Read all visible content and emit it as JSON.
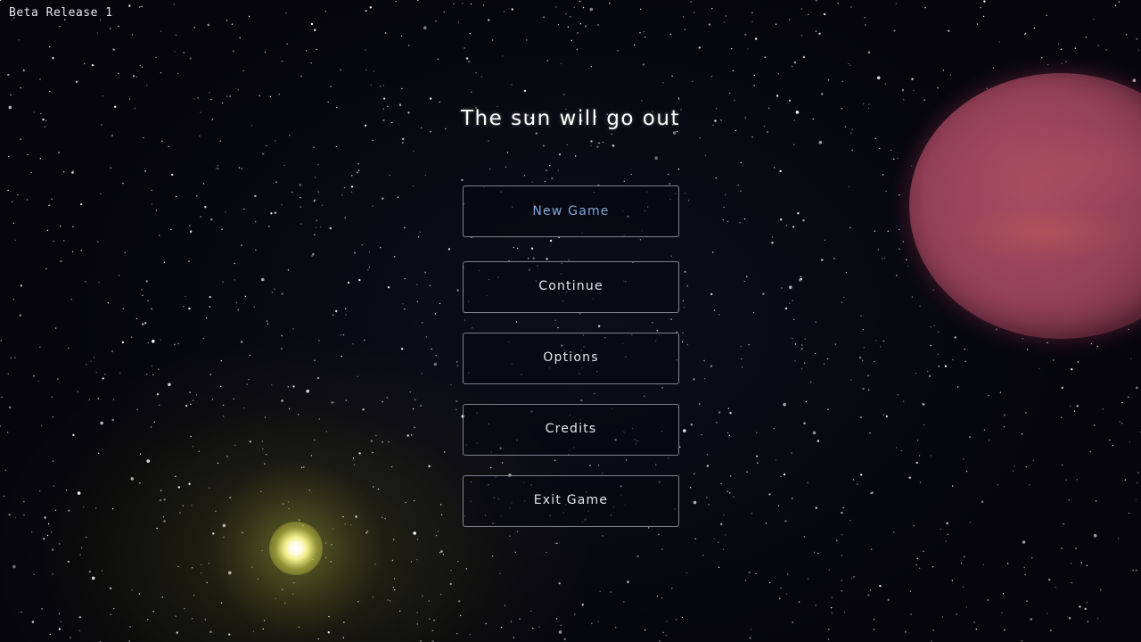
{
  "version_label": "Beta Release 1",
  "title": "The sun will go out",
  "menu": {
    "new_game": "New Game",
    "continue": "Continue",
    "options": "Options",
    "credits": "Credits",
    "exit_game": "Exit Game"
  },
  "colors": {
    "active_button_text": "#7fa8d8",
    "button_text": "#e6e6ea",
    "button_border": "#aaaab9",
    "planet": "#9c3f58",
    "sun_glow": "#f0ee8a"
  }
}
